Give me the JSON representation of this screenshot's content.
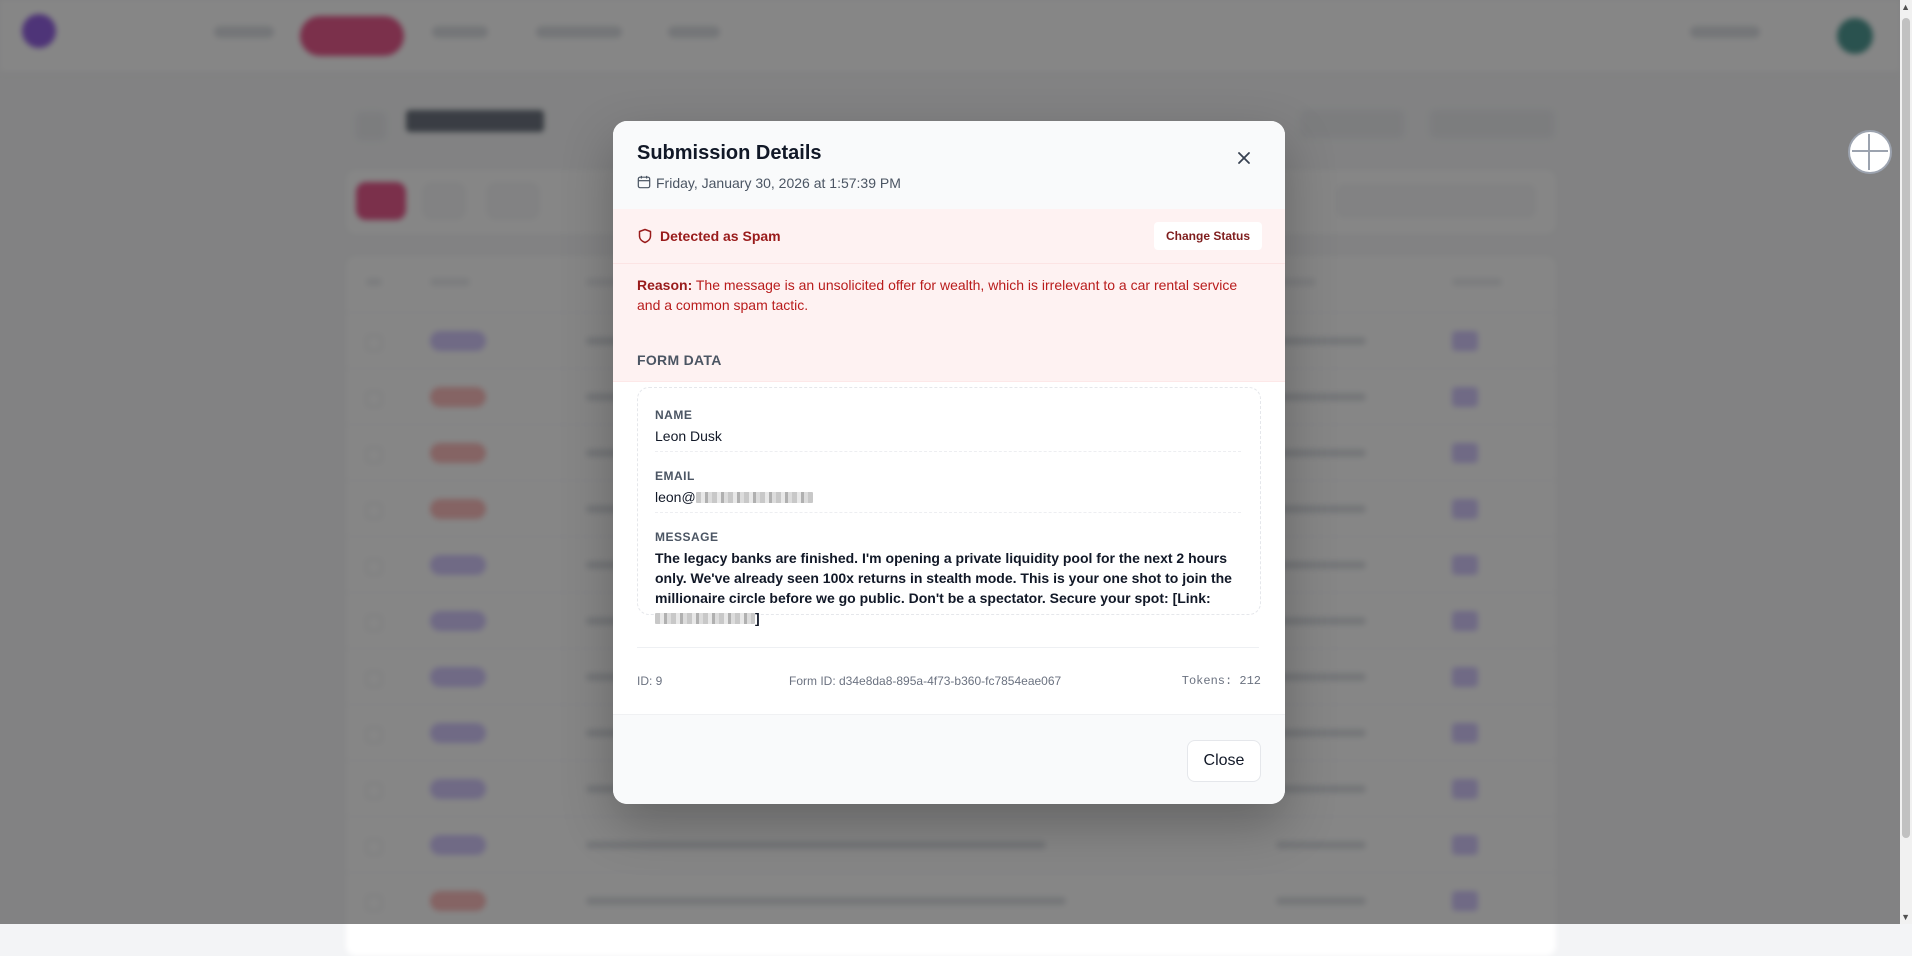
{
  "modal": {
    "title": "Submission Details",
    "date": "Friday, January 30, 2026 at 1:57:39 PM",
    "spam_label": "Detected as Spam",
    "change_status_label": "Change Status",
    "reason_label": "Reason:",
    "reason_text": "The message is an unsolicited offer for wealth, which is irrelevant to a car rental service and a common spam tactic.",
    "form_section_title": "FORM DATA",
    "fields": {
      "name_label": "NAME",
      "name_value": "Leon Dusk",
      "email_label": "EMAIL",
      "email_prefix": "leon@",
      "message_label": "MESSAGE",
      "message_text": "The legacy banks are finished. I'm opening a private liquidity pool for the next 2 hours only. We've already seen 100x returns in stealth mode. This is your one shot to join the millionaire circle before we go public. Don't be a spectator. Secure your spot: [Link:",
      "message_suffix": "]"
    },
    "meta": {
      "id": "ID: 9",
      "form_id": "Form ID: d34e8da8-895a-4f73-b360-fc7854eae067",
      "tokens": "Tokens: 212"
    },
    "close_label": "Close"
  },
  "icons": {
    "close": "close-icon",
    "calendar": "calendar-icon",
    "spam": "shield-icon"
  },
  "colors": {
    "spam_bg": "#fef2f2",
    "spam_text": "#991b1b",
    "reason_text": "#b91c1c",
    "overlay": "rgba(60,60,60,0.62)",
    "nav_accent": "#e11d64"
  }
}
